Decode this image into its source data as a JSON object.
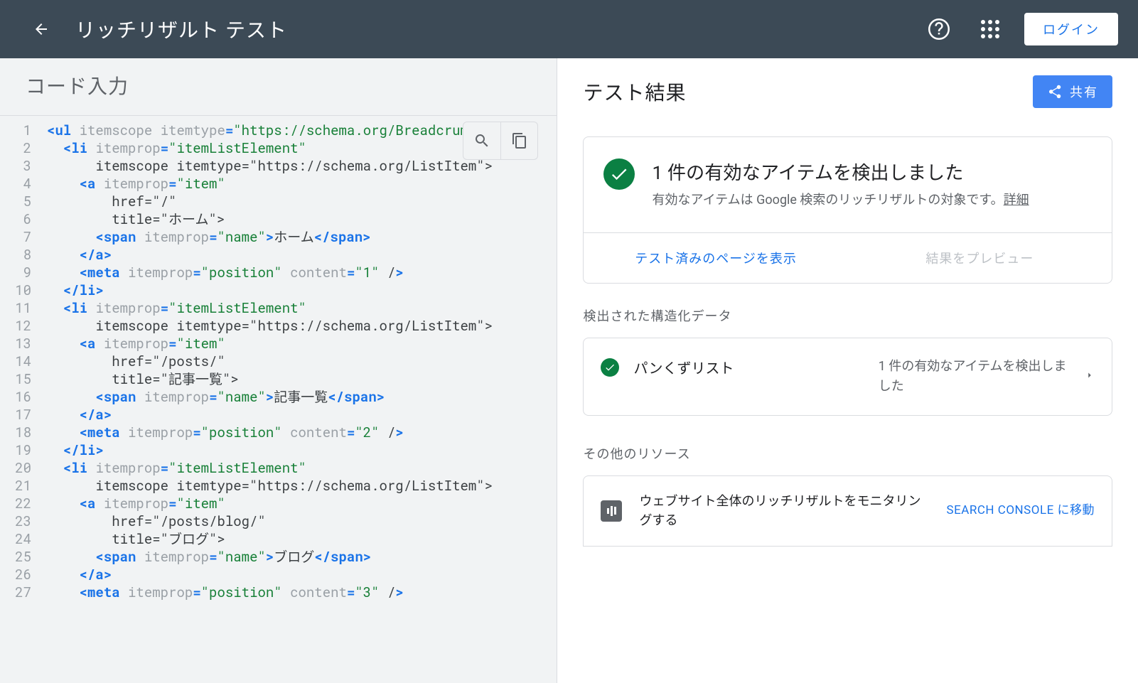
{
  "header": {
    "title": "リッチリザルト テスト",
    "login_label": "ログイン"
  },
  "left": {
    "heading": "コード入力",
    "code_lines": [
      {
        "n": 1,
        "indent": 0,
        "raw": "<ul itemscope itemtype=\"https://schema.org/BreadcrumbList\">"
      },
      {
        "n": 2,
        "indent": 1,
        "raw": "<li itemprop=\"itemListElement\""
      },
      {
        "n": 3,
        "indent": 3,
        "raw": "itemscope itemtype=\"https://schema.org/ListItem\">"
      },
      {
        "n": 4,
        "indent": 2,
        "raw": "<a itemprop=\"item\""
      },
      {
        "n": 5,
        "indent": 4,
        "raw": "href=\"/\""
      },
      {
        "n": 6,
        "indent": 4,
        "raw": "title=\"ホーム\">"
      },
      {
        "n": 7,
        "indent": 3,
        "raw": "<span itemprop=\"name\">ホーム</span>"
      },
      {
        "n": 8,
        "indent": 2,
        "raw": "</a>"
      },
      {
        "n": 9,
        "indent": 2,
        "raw": "<meta itemprop=\"position\" content=\"1\" />"
      },
      {
        "n": 10,
        "indent": 1,
        "raw": "</li>"
      },
      {
        "n": 11,
        "indent": 1,
        "raw": "<li itemprop=\"itemListElement\""
      },
      {
        "n": 12,
        "indent": 3,
        "raw": "itemscope itemtype=\"https://schema.org/ListItem\">"
      },
      {
        "n": 13,
        "indent": 2,
        "raw": "<a itemprop=\"item\""
      },
      {
        "n": 14,
        "indent": 4,
        "raw": "href=\"/posts/\""
      },
      {
        "n": 15,
        "indent": 4,
        "raw": "title=\"記事一覧\">"
      },
      {
        "n": 16,
        "indent": 3,
        "raw": "<span itemprop=\"name\">記事一覧</span>"
      },
      {
        "n": 17,
        "indent": 2,
        "raw": "</a>"
      },
      {
        "n": 18,
        "indent": 2,
        "raw": "<meta itemprop=\"position\" content=\"2\" />"
      },
      {
        "n": 19,
        "indent": 1,
        "raw": "</li>"
      },
      {
        "n": 20,
        "indent": 1,
        "raw": "<li itemprop=\"itemListElement\""
      },
      {
        "n": 21,
        "indent": 3,
        "raw": "itemscope itemtype=\"https://schema.org/ListItem\">"
      },
      {
        "n": 22,
        "indent": 2,
        "raw": "<a itemprop=\"item\""
      },
      {
        "n": 23,
        "indent": 4,
        "raw": "href=\"/posts/blog/\""
      },
      {
        "n": 24,
        "indent": 4,
        "raw": "title=\"ブログ\">"
      },
      {
        "n": 25,
        "indent": 3,
        "raw": "<span itemprop=\"name\">ブログ</span>"
      },
      {
        "n": 26,
        "indent": 2,
        "raw": "</a>"
      },
      {
        "n": 27,
        "indent": 2,
        "raw": "<meta itemprop=\"position\" content=\"3\" />"
      }
    ]
  },
  "right": {
    "heading": "テスト結果",
    "share_label": "共有",
    "status": {
      "title": "1 件の有効なアイテムを検出しました",
      "desc_pre": "有効なアイテムは Google 検索のリッチリザルトの対象です。",
      "link": "詳細"
    },
    "actions": {
      "view_page": "テスト済みのページを表示",
      "preview": "結果をプレビュー"
    },
    "detected_label": "検出された構造化データ",
    "item": {
      "name": "パンくずリスト",
      "detail": "1 件の有効なアイテムを検出しました"
    },
    "other_label": "その他のリソース",
    "other": {
      "msg": "ウェブサイト全体のリッチリザルトをモニタリングする",
      "go": "SEARCH CONSOLE に移動"
    }
  }
}
